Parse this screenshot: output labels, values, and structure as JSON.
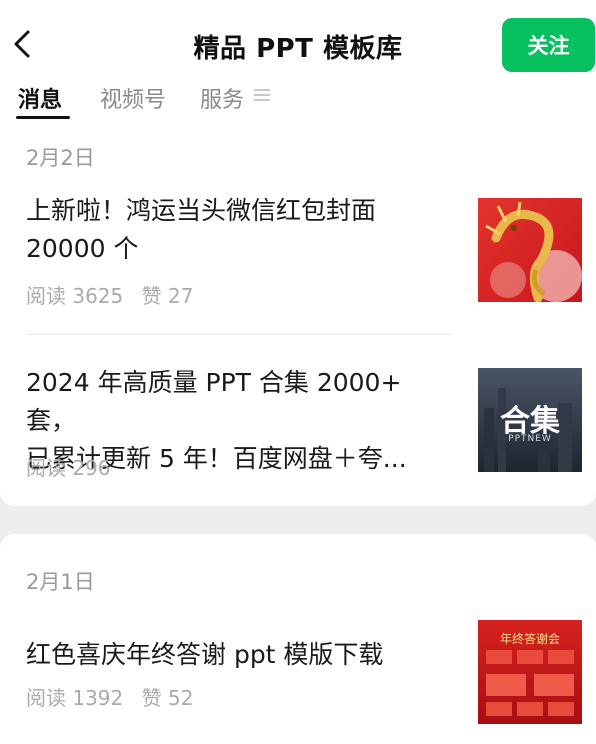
{
  "header": {
    "title": "精品 PPT 模板库",
    "follow_label": "关注"
  },
  "tabs": [
    {
      "label": "消息",
      "active": true
    },
    {
      "label": "视频号",
      "active": false
    },
    {
      "label": "服务",
      "active": false
    }
  ],
  "groups": [
    {
      "date": "2月2日",
      "articles": [
        {
          "title_lines": [
            "上新啦！鸿运当头微信红包封面",
            "20000 个"
          ],
          "read_label": "阅读 3625",
          "like_label": "赞 27",
          "thumb_icon": "golden-dragon-thumbnail"
        },
        {
          "title_lines": [
            "2024 年高质量 PPT 合集 2000+ 套，",
            "已累计更新 5 年！百度网盘＋夸..."
          ],
          "read_label": "阅读 296",
          "like_label": "",
          "thumb_icon": "collection-thumbnail",
          "thumb_text": "合集",
          "thumb_subtext": "PPTNEW"
        }
      ]
    },
    {
      "date": "2月1日",
      "articles": [
        {
          "title_lines": [
            "红色喜庆年终答谢 ppt 模版下载"
          ],
          "read_label": "阅读 1392",
          "like_label": "赞 52",
          "thumb_icon": "red-year-end-thumbnail",
          "thumb_text": "年终答谢会"
        }
      ]
    }
  ],
  "colors": {
    "accent": "#07c160",
    "background": "#ededed",
    "meta": "#aaaaaa"
  }
}
